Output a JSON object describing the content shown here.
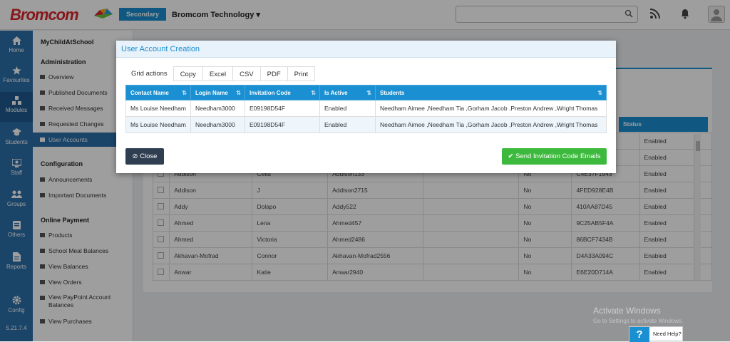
{
  "app": {
    "logo": "Bromcom",
    "badge": "Secondary",
    "school": "Bromcom Technology",
    "version": "5.21.7.4"
  },
  "rail": [
    {
      "label": "Home",
      "icon": "home-icon"
    },
    {
      "label": "Favourites",
      "icon": "star-icon"
    },
    {
      "label": "Modules",
      "icon": "modules-icon"
    },
    {
      "label": "Students",
      "icon": "students-icon"
    },
    {
      "label": "Staff",
      "icon": "staff-icon"
    },
    {
      "label": "Groups",
      "icon": "groups-icon"
    },
    {
      "label": "Others",
      "icon": "others-icon"
    },
    {
      "label": "Reports",
      "icon": "reports-icon"
    },
    {
      "label": "Config",
      "icon": "config-icon"
    }
  ],
  "nav": {
    "title": "MyChildAtSchool",
    "admin_heading": "Administration",
    "admin_items": [
      "Overview",
      "Published Documents",
      "Received Messages",
      "Requested Changes",
      "User Accounts"
    ],
    "config_heading": "Configuration",
    "config_items": [
      "Announcements",
      "Important Documents"
    ],
    "payment_heading": "Online Payment",
    "payment_items": [
      "Products",
      "School Meal Balances",
      "View Balances",
      "View Orders",
      "View PayPoint Account Balances",
      "View Purchases"
    ]
  },
  "background_table": {
    "status_header": "Status",
    "rows": [
      {
        "last": "",
        "first": "",
        "login": "",
        "active": "",
        "code": "",
        "status": "Enabled"
      },
      {
        "last": "",
        "first": "",
        "login": "",
        "active": "",
        "code": "",
        "status": "Enabled"
      },
      {
        "last": "Addison",
        "first": "Celia",
        "login": "Addison133",
        "active": "No",
        "code": "C4E37F1943",
        "status": "Enabled"
      },
      {
        "last": "Addison",
        "first": "J",
        "login": "Addison2715",
        "active": "No",
        "code": "4FED928E4B",
        "status": "Enabled"
      },
      {
        "last": "Addy",
        "first": "Dolapo",
        "login": "Addy522",
        "active": "No",
        "code": "410AA87D45",
        "status": "Enabled"
      },
      {
        "last": "Ahmed",
        "first": "Lena",
        "login": "Ahmed457",
        "active": "No",
        "code": "9C25AB5F4A",
        "status": "Enabled"
      },
      {
        "last": "Ahmed",
        "first": "Victoria",
        "login": "Ahmed2486",
        "active": "No",
        "code": "86BCF7434B",
        "status": "Enabled"
      },
      {
        "last": "Akhavan-Mofrad",
        "first": "Connor",
        "login": "Akhavan-Mofrad2556",
        "active": "No",
        "code": "D4A33A094C",
        "status": "Enabled"
      },
      {
        "last": "Anwar",
        "first": "Katie",
        "login": "Anwar2940",
        "active": "No",
        "code": "E6E20D714A",
        "status": "Enabled"
      }
    ]
  },
  "modal": {
    "title": "User Account Creation",
    "grid_actions_label": "Grid actions",
    "grid_buttons": [
      "Copy",
      "Excel",
      "CSV",
      "PDF",
      "Print"
    ],
    "columns": [
      "Contact Name",
      "Login Name",
      "Invitation Code",
      "Is Active",
      "Students"
    ],
    "rows": [
      [
        "Ms Louise Needham",
        "Needham3000",
        "E09198D54F",
        "Enabled",
        "Needham Aimee ,Needham Tia ,Gorham Jacob ,Preston Andrew ,Wright Thomas"
      ],
      [
        "Ms Louise Needham",
        "Needham3000",
        "E09198D54F",
        "Enabled",
        "Needham Aimee ,Needham Tia ,Gorham Jacob ,Preston Andrew ,Wright Thomas"
      ]
    ],
    "close_label": "Close",
    "send_label": "Send Invitation Code Emails"
  },
  "watermark": {
    "line1": "Activate Windows",
    "line2": "Go to Settings to activate Windows."
  },
  "help": {
    "label": "Need Help?"
  },
  "colors": {
    "brand_red": "#d9262c",
    "accent_blue": "#1a8fd1",
    "rail_blue": "#2a6ea8",
    "success_green": "#3dba3d",
    "dark_button": "#2f3e50"
  }
}
